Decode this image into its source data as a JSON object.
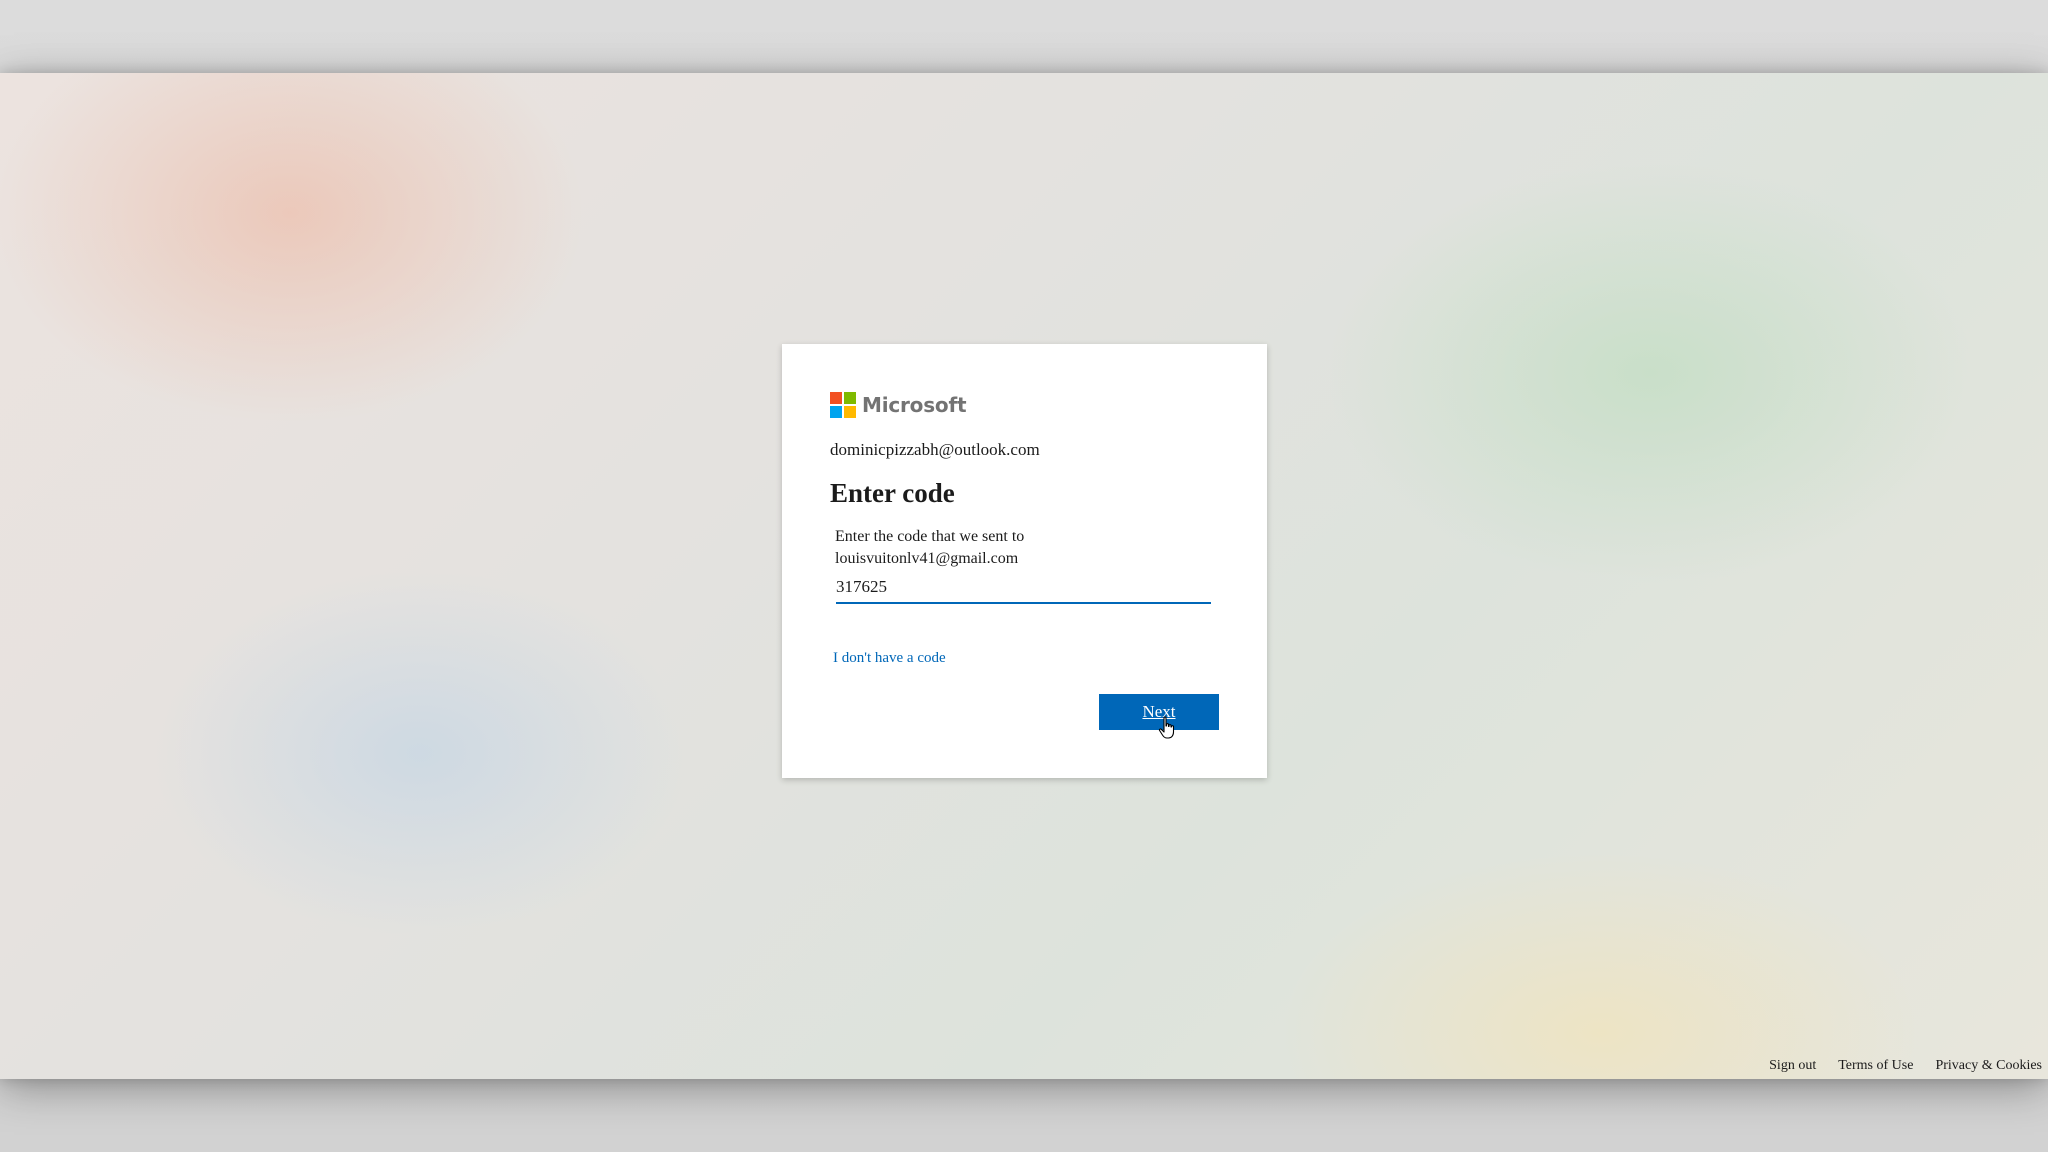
{
  "brand": {
    "name": "Microsoft",
    "logo_colors": [
      "#f25022",
      "#7fba00",
      "#00a4ef",
      "#ffb900"
    ]
  },
  "login": {
    "identity": "dominicpizzabh@outlook.com",
    "title": "Enter code",
    "description_line1": "Enter the code that we sent to",
    "description_line2": "louisvuitonlv41@gmail.com",
    "code_value": "317625",
    "no_code_link": "I don't have a code",
    "next_label": "Next"
  },
  "footer": {
    "sign_out": "Sign out",
    "terms": "Terms of Use",
    "privacy": "Privacy & Cookies"
  },
  "colors": {
    "accent": "#0067b8"
  }
}
